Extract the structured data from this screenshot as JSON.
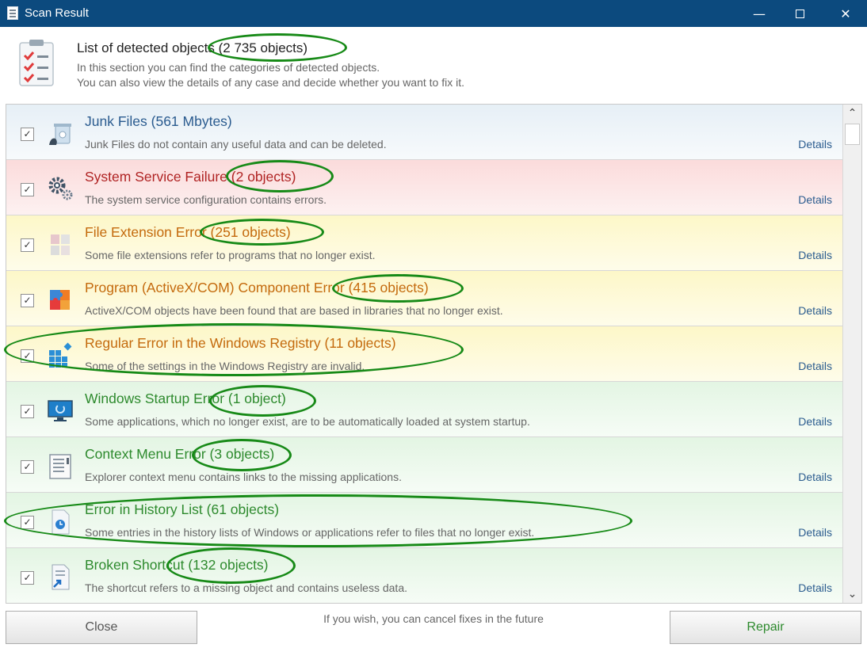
{
  "window": {
    "title": "Scan Result",
    "minimize_glyph": "—",
    "close_glyph": "✕"
  },
  "header": {
    "title": "List of detected objects (2 735 objects)",
    "desc_line1": "In this section you can find the categories of detected objects.",
    "desc_line2": "You can also view the details of any case and decide whether you want to fix it."
  },
  "items": [
    {
      "title": "Junk Files (561 Mbytes)",
      "desc": "Junk Files do not contain any useful data and can be deleted.",
      "details": "Details",
      "checked": true,
      "color": "blue",
      "icon": "trash-bin-icon"
    },
    {
      "title": "System Service Failure (2 objects)",
      "desc": "The system service configuration contains errors.",
      "details": "Details",
      "checked": true,
      "color": "red",
      "icon": "gears-icon"
    },
    {
      "title": "File Extension Error (251 objects)",
      "desc": "Some file extensions refer to programs that no longer exist.",
      "details": "Details",
      "checked": true,
      "color": "yellow",
      "icon": "file-extension-icon"
    },
    {
      "title": "Program (ActiveX/COM) Component Error (415 objects)",
      "desc": "ActiveX/COM objects have been found that are based in libraries that no longer exist.",
      "details": "Details",
      "checked": true,
      "color": "yellow",
      "icon": "puzzle-icon"
    },
    {
      "title": "Regular Error in the Windows Registry (11 objects)",
      "desc": "Some of the settings in the Windows Registry are invalid.",
      "details": "Details",
      "checked": true,
      "color": "yellow",
      "icon": "registry-icon"
    },
    {
      "title": "Windows Startup Error (1 object)",
      "desc": "Some applications, which no longer exist, are to be automatically loaded at system startup.",
      "details": "Details",
      "checked": true,
      "color": "green",
      "icon": "monitor-icon"
    },
    {
      "title": "Context Menu Error (3 objects)",
      "desc": "Explorer context menu contains links to the missing applications.",
      "details": "Details",
      "checked": true,
      "color": "green",
      "icon": "context-menu-icon"
    },
    {
      "title": "Error in History List (61 objects)",
      "desc": "Some entries in the history lists of Windows or applications refer to files that no longer exist.",
      "details": "Details",
      "checked": true,
      "color": "green",
      "icon": "history-icon"
    },
    {
      "title": "Broken Shortcut (132 objects)",
      "desc": "The shortcut refers to a missing object and contains useless data.",
      "details": "Details",
      "checked": true,
      "color": "green",
      "icon": "shortcut-icon"
    }
  ],
  "checkbox_glyph": "✓",
  "scroll": {
    "up": "⌃",
    "down": "⌄"
  },
  "footer": {
    "close_label": "Close",
    "note": "If you wish, you can cancel fixes in the future",
    "repair_label": "Repair"
  },
  "colors": {
    "titlebar": "#0c4a7e",
    "annotation_circle": "#178a17"
  }
}
